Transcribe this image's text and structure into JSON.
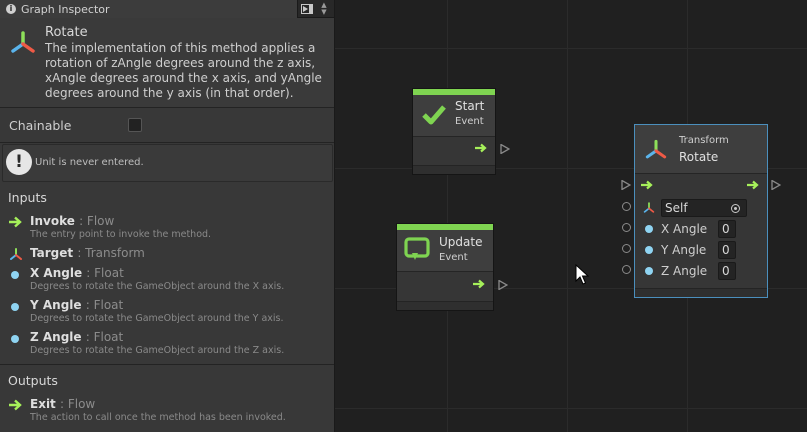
{
  "window": {
    "tab_title": "Graph Inspector"
  },
  "inspector": {
    "method_title": "Rotate",
    "method_description": "The implementation of this method applies a rotation of zAngle degrees around the z axis, xAngle degrees around the x axis, and yAngle degrees around the y axis (in that order).",
    "chainable_label": "Chainable",
    "chainable_checked": false,
    "warning_text": "Unit is never entered.",
    "inputs_title": "Inputs",
    "inputs": [
      {
        "name": "Invoke",
        "type": ": Flow",
        "description": "The entry point to invoke the method.",
        "icon": "flow-arrow-icon"
      },
      {
        "name": "Target",
        "type": ": Transform",
        "description": "",
        "icon": "transform-icon"
      },
      {
        "name": "X Angle",
        "type": ": Float",
        "description": "Degrees to rotate the GameObject around the X axis.",
        "icon": "float-dot-icon"
      },
      {
        "name": "Y Angle",
        "type": ": Float",
        "description": "Degrees to rotate the GameObject around the Y axis.",
        "icon": "float-dot-icon"
      },
      {
        "name": "Z Angle",
        "type": ": Float",
        "description": "Degrees to rotate the GameObject around the Z axis.",
        "icon": "float-dot-icon"
      }
    ],
    "outputs_title": "Outputs",
    "outputs": [
      {
        "name": "Exit",
        "type": ": Flow",
        "description": "The action to call once the method has been invoked.",
        "icon": "flow-arrow-icon"
      }
    ]
  },
  "graph": {
    "start_unit": {
      "title": "Start",
      "subtitle": "Event"
    },
    "update_unit": {
      "title": "Update",
      "subtitle": "Event"
    },
    "transform_unit": {
      "subtitle": "Transform",
      "title": "Rotate",
      "target_value": "Self",
      "fields": [
        {
          "label": "X Angle",
          "value": "0"
        },
        {
          "label": "Y Angle",
          "value": "0"
        },
        {
          "label": "Z Angle",
          "value": "0"
        }
      ]
    }
  },
  "colors": {
    "event_green": "#7fd451",
    "flow_green": "#a6f05a",
    "float_blue": "#8fd4f2",
    "selection_blue": "#4b8fbd"
  }
}
